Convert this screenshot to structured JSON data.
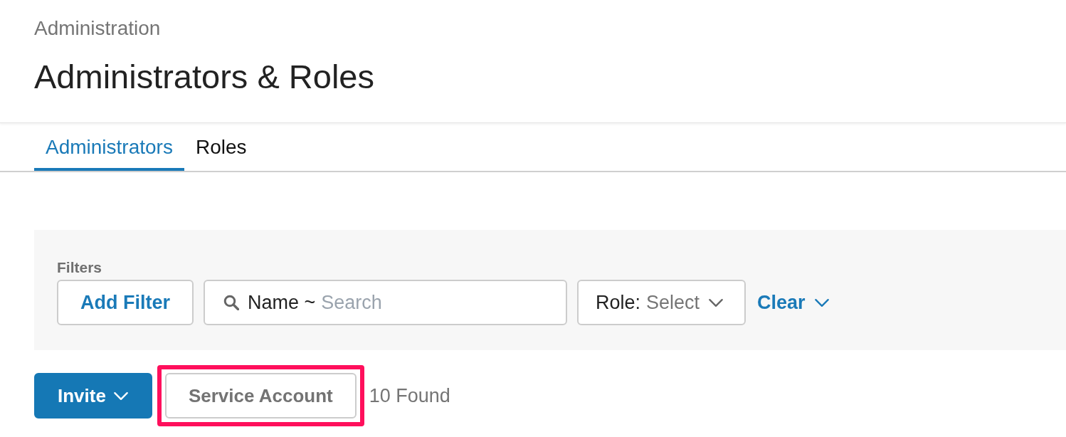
{
  "header": {
    "breadcrumb": "Administration",
    "title": "Administrators & Roles"
  },
  "tabs": [
    {
      "label": "Administrators",
      "selected": true
    },
    {
      "label": "Roles",
      "selected": false
    }
  ],
  "filters": {
    "label": "Filters",
    "add_button": "Add Filter",
    "search": {
      "prefix": "Name ~",
      "placeholder": "Search"
    },
    "role_select": {
      "label": "Role:",
      "placeholder": "Select"
    },
    "clear_button": "Clear"
  },
  "actions": {
    "buttons": [
      {
        "label": "Invite",
        "kind": "primary",
        "dropdown": true,
        "highlighted": false
      },
      {
        "label": "Service Account",
        "kind": "secondary",
        "dropdown": false,
        "highlighted": true
      }
    ],
    "result_count": "10 Found"
  }
}
